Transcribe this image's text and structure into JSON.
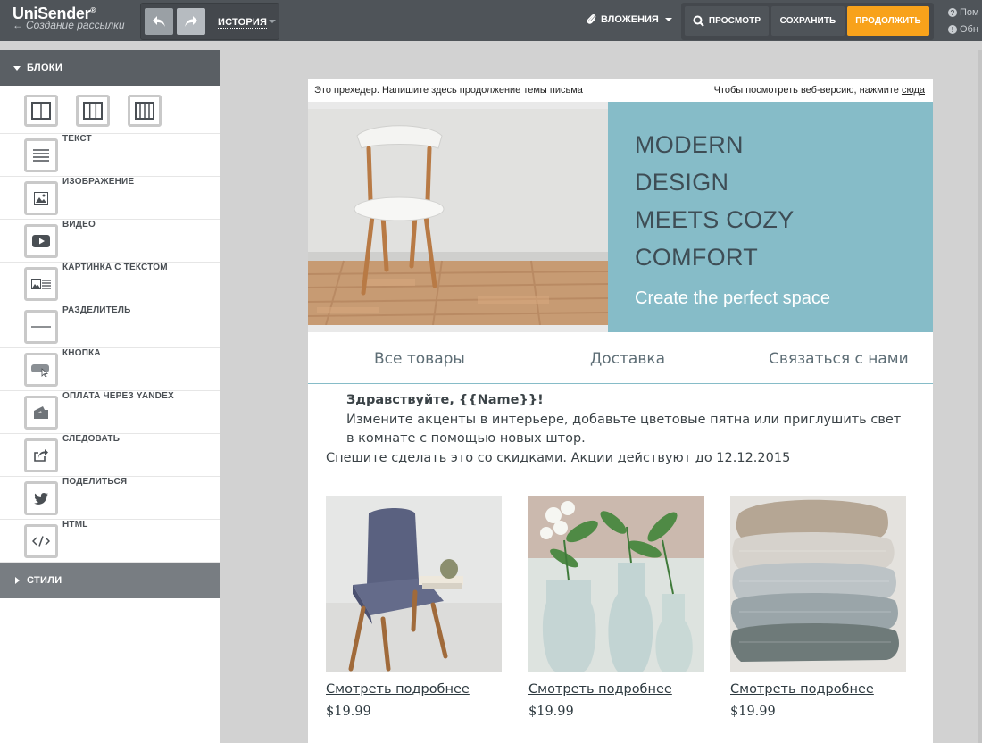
{
  "header": {
    "logo": "UniSender",
    "logo_mark": "®",
    "back_label": "Создание рассылки",
    "history_label": "ИСТОРИЯ",
    "attachments_label": "ВЛОЖЕНИЯ",
    "preview_label": "ПРОСМОТР",
    "save_label": "СОХРАНИТЬ",
    "continue_label": "ПРОДОЛЖИТЬ",
    "help_1": "Пом",
    "help_2": "Обн"
  },
  "sidebar": {
    "blocks_title": "БЛОКИ",
    "styles_title": "СТИЛИ",
    "items": [
      {
        "label": "ТЕКСТ",
        "icon": "text-block-icon"
      },
      {
        "label": "ИЗОБРАЖЕНИЕ",
        "icon": "image-block-icon"
      },
      {
        "label": "ВИДЕО",
        "icon": "video-block-icon"
      },
      {
        "label": "КАРТИНКА С ТЕКСТОМ",
        "icon": "image-text-block-icon"
      },
      {
        "label": "РАЗДЕЛИТЕЛЬ",
        "icon": "divider-block-icon"
      },
      {
        "label": "КНОПКА",
        "icon": "button-block-icon"
      },
      {
        "label": "ОПЛАТА ЧЕРЕЗ YANDEX",
        "icon": "yandex-payment-icon"
      },
      {
        "label": "СЛЕДОВАТЬ",
        "icon": "follow-icon"
      },
      {
        "label": "ПОДЕЛИТЬСЯ",
        "icon": "twitter-share-icon"
      },
      {
        "label": "HTML",
        "icon": "html-code-icon"
      }
    ]
  },
  "email": {
    "preheader": "Это прехедер. Напишите здесь продолжение темы письма",
    "webview_text": "Чтобы посмотреть веб-версию, нажмите",
    "webview_link": "сюда",
    "hero_lines": [
      "MODERN",
      "DESIGN",
      "MEETS COZY",
      "COMFORT"
    ],
    "hero_subtitle": "Create the perfect space",
    "nav": [
      "Все товары",
      "Доставка",
      "Связаться с нами"
    ],
    "greeting": "Здравствуйте, {{Name}}!",
    "paragraph": "Измените акценты в интерьере, добавьте цветовые пятна или приглушить свет в комнате с помощью новых штор.",
    "paragraph2": "Спешите сделать это со скидками. Акции действуют до 12.12.2015",
    "products": [
      {
        "link": "Смотреть подробнее",
        "price": "$19.99"
      },
      {
        "link": "Смотреть подробнее",
        "price": "$19.99"
      },
      {
        "link": "Смотреть подробнее",
        "price": "$19.99"
      }
    ]
  },
  "colors": {
    "topbar": "#4f5459",
    "accent": "#f8a21b",
    "hero_panel": "#86bcc8",
    "sidebar_header": "#5a5f64"
  }
}
